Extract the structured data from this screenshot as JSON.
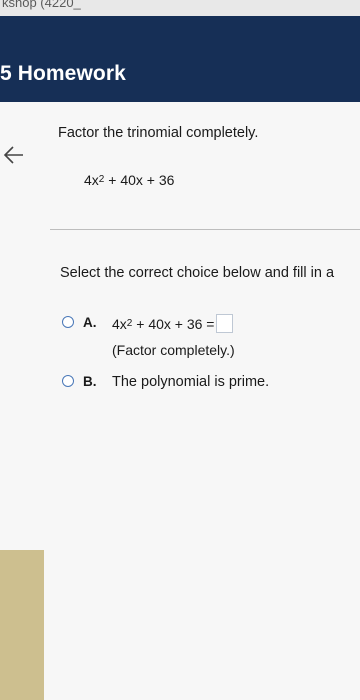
{
  "browser": {
    "tab_title": "kshop (4220_"
  },
  "header": {
    "title": "5 Homework"
  },
  "question": {
    "prompt": "Factor the trinomial completely.",
    "expr_coef": "4x",
    "expr_exp": "2",
    "expr_rest": " + 40x + 36"
  },
  "instruction": "Select the correct choice below and fill in a",
  "choices": [
    {
      "letter": "A.",
      "expr_coef": "4x",
      "expr_exp": "2",
      "expr_rest": " + 40x + 36 =",
      "hint": "(Factor completely.)"
    },
    {
      "letter": "B.",
      "text": "The polynomial is prime."
    }
  ],
  "colors": {
    "header_bg": "#162f56",
    "radio_border": "#4a78b8",
    "side_strip": "#cdbf8f"
  },
  "icons": {
    "back": "arrow-left-icon",
    "radio": "radio-button-icon"
  }
}
